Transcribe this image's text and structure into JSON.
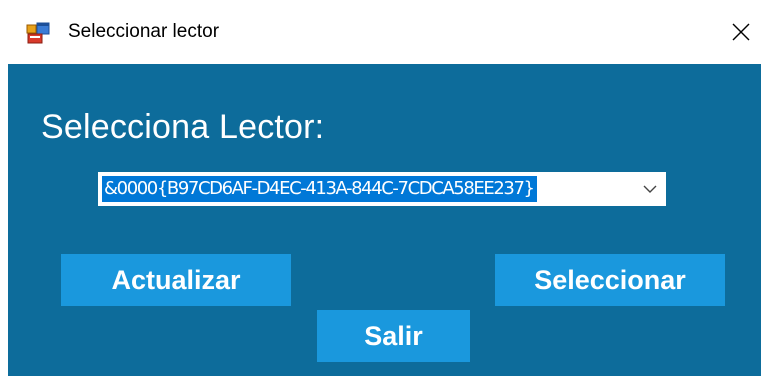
{
  "window": {
    "title": "Seleccionar lector",
    "app_icon": "form-icon",
    "close_icon": "close-icon"
  },
  "main": {
    "heading": "Selecciona Lector:",
    "reader_select": {
      "selected_value": "&0000{B97CD6AF-D4EC-413A-844C-7CDCA58EE237}",
      "arrow_icon": "chevron-down-icon"
    },
    "buttons": {
      "refresh_label": "Actualizar",
      "select_label": "Seleccionar",
      "exit_label": "Salir"
    }
  },
  "colors": {
    "client_background": "#0d6c9b",
    "button_background": "#1a98dd",
    "selection_highlight": "#0078d7",
    "text_light": "#ffffff"
  }
}
